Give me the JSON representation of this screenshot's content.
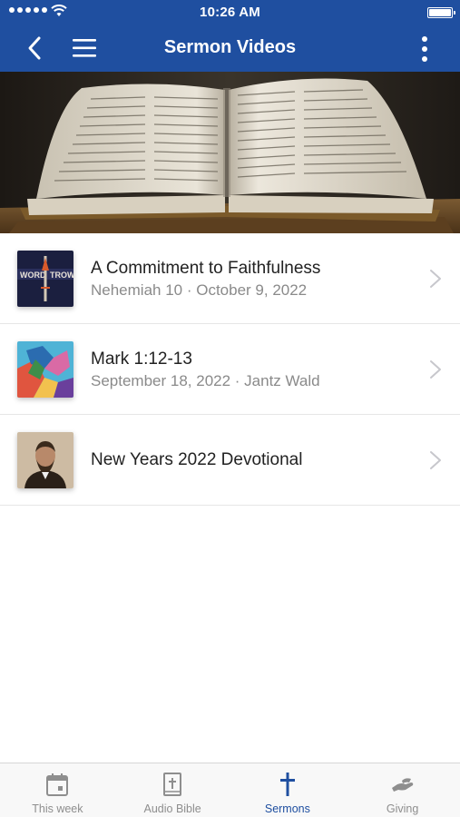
{
  "status_bar": {
    "time": "10:26 AM"
  },
  "nav": {
    "title": "Sermon Videos"
  },
  "hero": {
    "icon": "open-bible-image"
  },
  "sermons": [
    {
      "title": "A Commitment to Faithfulness",
      "subtitle": "Nehemiah 10 · October 9, 2022",
      "thumb": "word-trowel-thumbnail"
    },
    {
      "title": "Mark 1:12-13",
      "subtitle": "September 18, 2022 · Jantz Wald",
      "thumb": "reaching-hands-painting-thumbnail"
    },
    {
      "title": "New Years 2022 Devotional",
      "subtitle": "",
      "thumb": "portrait-thumbnail"
    }
  ],
  "tabs": [
    {
      "label": "This week",
      "icon": "calendar-icon",
      "active": false
    },
    {
      "label": "Audio Bible",
      "icon": "bible-icon",
      "active": false
    },
    {
      "label": "Sermons",
      "icon": "cross-icon",
      "active": true
    },
    {
      "label": "Giving",
      "icon": "giving-hand-icon",
      "active": false
    }
  ],
  "colors": {
    "brand": "#1f4fa0",
    "inactive": "#8e8e8e",
    "subtitle": "#8a8a8a"
  }
}
